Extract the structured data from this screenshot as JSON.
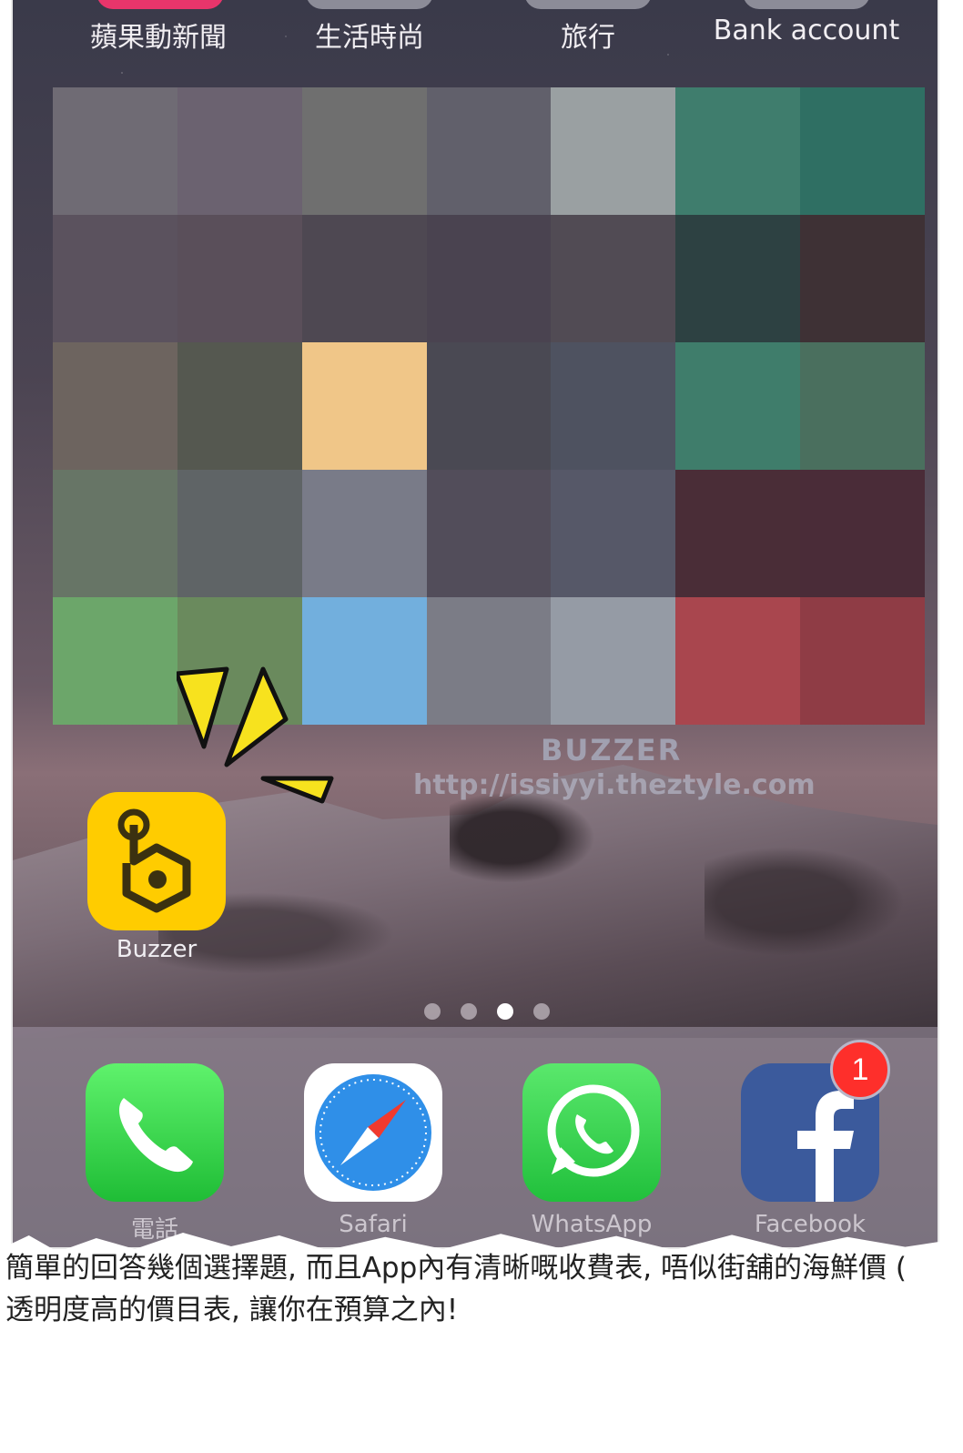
{
  "homescreen": {
    "top_row": [
      {
        "label": "蘋果動新聞",
        "color": "#e8356b"
      },
      {
        "label": "生活時尚",
        "color": "#8c8c98"
      },
      {
        "label": "旅行",
        "color": "#8c8c98"
      },
      {
        "label": "Bank account",
        "color": "#8c8c98"
      }
    ],
    "pixelated_cells": [
      [
        "#6f6b74",
        "#6b6270",
        "#6f6f6f",
        "#61606b",
        "#9aa0a2",
        "#3f7d6d",
        "#2f6f63"
      ],
      [
        "#5b525e",
        "#5a4f5a",
        "#4e4852",
        "#4a4350",
        "#514b54",
        "#2d4142",
        "#3e3135"
      ],
      [
        "#6d645f",
        "#555850",
        "#f0c688",
        "#4a4953",
        "#4e5260",
        "#3f7d6b",
        "#4a6f5e"
      ],
      [
        "#677566",
        "#5f6466",
        "#797b88",
        "#524d5a",
        "#565868",
        "#4a2d37",
        "#4a2c38"
      ],
      [
        "#6ca66a",
        "#6a8a5d",
        "#72afdd",
        "#7b7c86",
        "#959ba5",
        "#a9464e",
        "#8f3c45"
      ]
    ],
    "watermark": {
      "title": "BUZZER",
      "url": "http://issiyyi.theztyle.com"
    },
    "featured_app": {
      "label": "Buzzer",
      "icon": "buzzer-icon",
      "color": "#ffcc00"
    },
    "page_dots": {
      "count": 4,
      "active": 3
    },
    "dock": [
      {
        "label": "電話",
        "icon": "phone-icon"
      },
      {
        "label": "Safari",
        "icon": "safari-compass-icon"
      },
      {
        "label": "WhatsApp",
        "icon": "whatsapp-icon"
      },
      {
        "label": "Facebook",
        "icon": "facebook-icon",
        "badge": "1"
      }
    ]
  },
  "caption": {
    "line1": "簡單的回答幾個選擇題, 而且App內有清晰嘅收費表, 唔似街舖的海鮮價 (",
    "line2": "透明度高的價目表, 讓你在預算之內!"
  }
}
